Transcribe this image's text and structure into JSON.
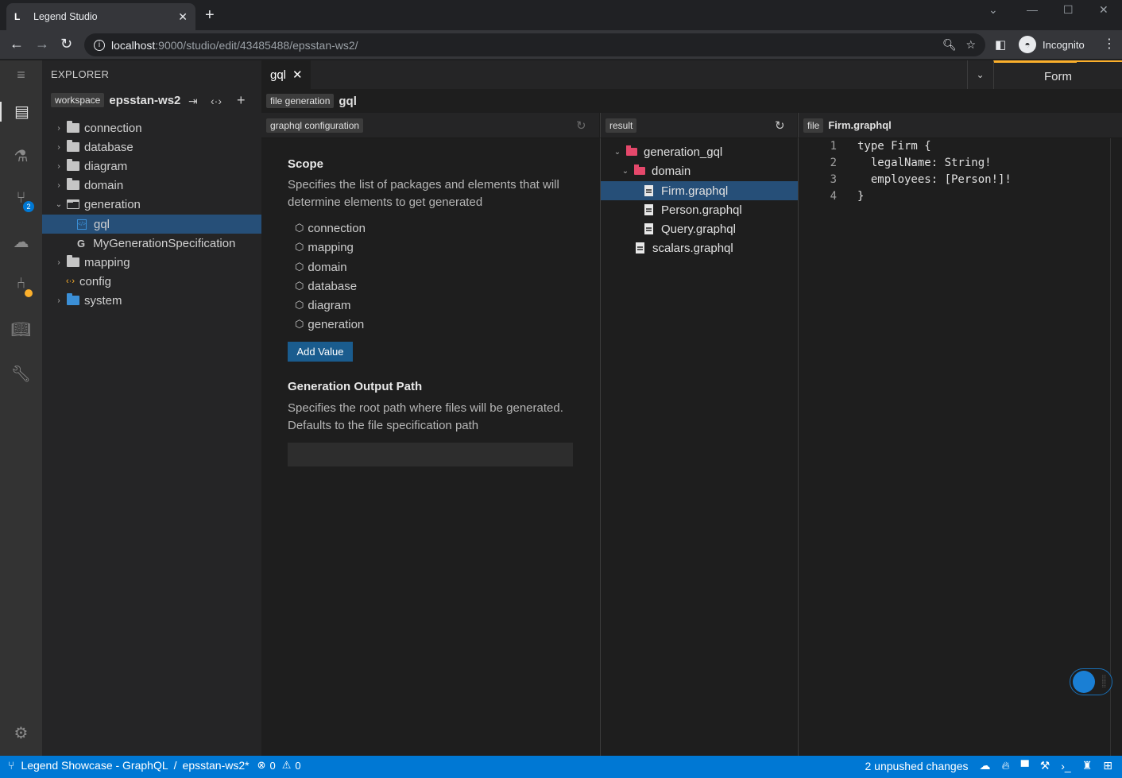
{
  "browser": {
    "tab_title": "Legend Studio",
    "tab_close": "✕",
    "new_tab": "+",
    "url_host": "localhost",
    "url_path": ":9000/studio/edit/43485488/epsstan-ws2/",
    "profile_label": "Incognito"
  },
  "explorer": {
    "title": "EXPLORER",
    "workspace_tag": "workspace",
    "workspace_name": "epsstan-ws2",
    "tree": [
      {
        "label": "connection"
      },
      {
        "label": "database"
      },
      {
        "label": "diagram"
      },
      {
        "label": "domain"
      },
      {
        "label": "generation"
      },
      {
        "label": "gql"
      },
      {
        "label": "MyGenerationSpecification",
        "icon_glyph": "G"
      },
      {
        "label": "mapping"
      },
      {
        "label": "config"
      },
      {
        "label": "system"
      }
    ]
  },
  "activity_bar": {
    "changes_badge": "2"
  },
  "editor": {
    "tab_label": "gql",
    "tab_close": "✕",
    "mode_label": "Form",
    "header_tag": "file generation",
    "header_title": "gql"
  },
  "config_panel": {
    "tag": "graphql configuration",
    "scope_title": "Scope",
    "scope_desc": "Specifies the list of packages and elements that will determine elements to get generated",
    "scope_items": [
      "connection",
      "mapping",
      "domain",
      "database",
      "diagram",
      "generation"
    ],
    "add_value_label": "Add Value",
    "output_title": "Generation Output Path",
    "output_desc": "Specifies the root path where files will be generated. Defaults to the file specification path",
    "output_value": ""
  },
  "result_panel": {
    "tag": "result",
    "items": [
      {
        "label": "generation_gql"
      },
      {
        "label": "domain"
      },
      {
        "label": "Firm.graphql"
      },
      {
        "label": "Person.graphql"
      },
      {
        "label": "Query.graphql"
      },
      {
        "label": "scalars.graphql"
      }
    ]
  },
  "code_panel": {
    "tag": "file",
    "file_name": "Firm.graphql",
    "lines": [
      {
        "n": "1",
        "text": "type Firm {"
      },
      {
        "n": "2",
        "text": "  legalName: String!"
      },
      {
        "n": "3",
        "text": "  employees: [Person!]!"
      },
      {
        "n": "4",
        "text": "}"
      }
    ]
  },
  "status_bar": {
    "project": "Legend Showcase - GraphQL",
    "separator": "/",
    "workspace": "epsstan-ws2*",
    "errors": "0",
    "warnings": "0",
    "changes": "2 unpushed changes"
  },
  "colors": {
    "accent": "#0078d4",
    "selection": "#264f78",
    "form_tab_accent": "#fcb02c",
    "result_folder": "#e5486b"
  }
}
